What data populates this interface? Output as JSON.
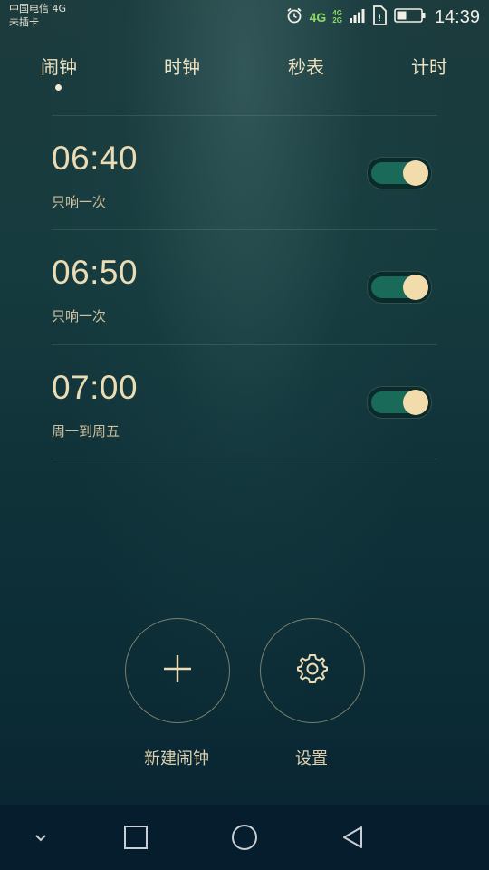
{
  "status_bar": {
    "carrier_line1": "中国电信 4G",
    "carrier_line2": "未插卡",
    "network": "4G",
    "mini_network_top": "4G",
    "mini_network_bottom": "2G",
    "time": "14:39",
    "icons": [
      "alarm-icon",
      "signal-icon",
      "sim-icon",
      "battery-icon"
    ]
  },
  "tabs": [
    {
      "label": "闹钟",
      "active": true
    },
    {
      "label": "时钟",
      "active": false
    },
    {
      "label": "秒表",
      "active": false
    },
    {
      "label": "计时",
      "active": false
    }
  ],
  "alarms": [
    {
      "time": "06:40",
      "repeat": "只响一次",
      "enabled": true
    },
    {
      "time": "06:50",
      "repeat": "只响一次",
      "enabled": true
    },
    {
      "time": "07:00",
      "repeat": "周一到周五",
      "enabled": true
    }
  ],
  "actions": {
    "new_alarm_label": "新建闹钟",
    "new_alarm_icon": "plus-icon",
    "settings_label": "设置",
    "settings_icon": "gear-icon"
  },
  "nav_bar": {
    "icons": [
      "chevron-down-icon",
      "recents-square-icon",
      "home-circle-icon",
      "back-triangle-icon"
    ]
  },
  "colors": {
    "accent_text": "#ecdcb4",
    "toggle_track": "#1a6a5a",
    "toggle_knob": "#f2dcac",
    "status_green": "#8fd96a"
  }
}
